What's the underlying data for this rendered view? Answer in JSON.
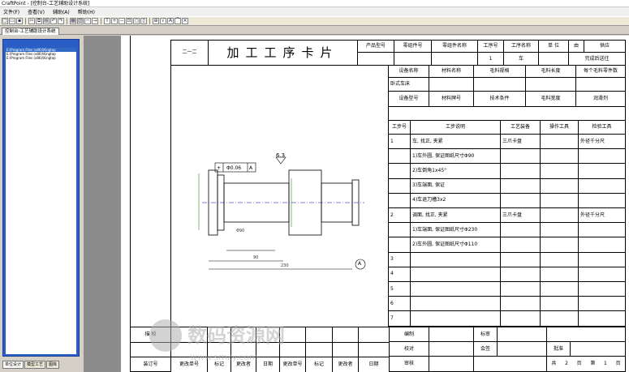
{
  "app": {
    "title": "CraftPoint - [控制台-工艺辅助设计系统]",
    "menus": [
      "文件(F)",
      "查看(V)",
      "辅助(A)",
      "帮助(H)"
    ],
    "doc_tab": "控制台-工艺辅助设计系统"
  },
  "left_panel": {
    "paths": [
      "E:\\Program Files (x86)\\Kingtop",
      "E:\\Program Files (x86)\\Kingtop",
      "E:\\Program Files (x86)\\Kingtop"
    ],
    "tabs": [
      "单位设计",
      "模型工艺",
      "图库"
    ]
  },
  "card": {
    "code": "二一二",
    "title": "加工工序卡片",
    "header": {
      "product_model": "产品型号",
      "part_no": "零组件号",
      "part_name": "零组件名称",
      "process_no": "工序号",
      "process_name": "工序名称",
      "unit": "单 位",
      "from": "由",
      "supply": "供应",
      "process_no_val": "1",
      "process_name_val": "车",
      "send_to": "完成后送往"
    },
    "materials": {
      "equipment_name": "设备名称",
      "material_name": "材料名称",
      "blank_spec": "毛料规格",
      "blank_length": "毛料长度",
      "per_blank": "每个毛料零件数",
      "equipment_val": "卧式车床",
      "equipment_model": "设备型号",
      "material_no": "材料牌号",
      "tech_cond": "技术条件",
      "blank_width": "毛料宽度",
      "lubricant": "润滑剂"
    },
    "steps_header": {
      "step_no": "工步号",
      "step_desc": "工步说明",
      "process_equipment": "工艺装备",
      "operation_tool": "操作工具",
      "inspection_tool": "检验工具"
    },
    "steps": [
      {
        "no": "1",
        "desc": "车, 找正, 夹紧",
        "equip": "三爪卡盘",
        "inspect": "外径千分尺"
      },
      {
        "no": "",
        "desc": "1)车外圆, 保证图纸尺寸Φ90",
        "equip": "",
        "inspect": ""
      },
      {
        "no": "",
        "desc": "2)车倒角1x45°",
        "equip": "",
        "inspect": ""
      },
      {
        "no": "",
        "desc": "3)车端面, 保证",
        "equip": "",
        "inspect": ""
      },
      {
        "no": "",
        "desc": "4)车退刀槽3x2",
        "equip": "",
        "inspect": ""
      },
      {
        "no": "2",
        "desc": "调面, 找正, 夹紧",
        "equip": "三爪卡盘",
        "inspect": "外径千分尺"
      },
      {
        "no": "",
        "desc": "1)车端面, 保证图纸尺寸Φ230",
        "equip": "",
        "inspect": ""
      },
      {
        "no": "",
        "desc": "2)车外圆, 保证图纸尺寸Φ110",
        "equip": "",
        "inspect": ""
      },
      {
        "no": "3",
        "desc": "",
        "equip": "",
        "inspect": ""
      },
      {
        "no": "4",
        "desc": "",
        "equip": "",
        "inspect": ""
      },
      {
        "no": "5",
        "desc": "",
        "equip": "",
        "inspect": ""
      },
      {
        "no": "6",
        "desc": "",
        "equip": "",
        "inspect": ""
      },
      {
        "no": "7",
        "desc": "",
        "equip": "",
        "inspect": ""
      }
    ],
    "drawing": {
      "tol_value": "Φ0.06",
      "tol_ref": "A",
      "roughness": "6.3",
      "datum": "A",
      "dim_total": "230",
      "dim_mid": "90",
      "dim_left": "Φ90"
    },
    "footer": {
      "trace": "描 校",
      "design": "编制",
      "check": "校对",
      "review": "审核",
      "countersign": "会签",
      "std": "标审",
      "approve": "批准",
      "total": "共",
      "sheet": "页",
      "page": "第",
      "total_val": "2",
      "page_val": "1",
      "labels": [
        "装订号",
        "更改单号",
        "标记",
        "更改者",
        "日期",
        "更改单号",
        "标记",
        "更改者",
        "日期"
      ]
    }
  },
  "watermark": {
    "text": "数码资源网",
    "url": "www.smzy.com"
  }
}
